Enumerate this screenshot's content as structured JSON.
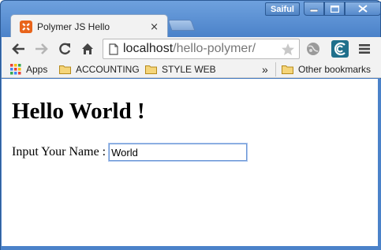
{
  "window": {
    "user_name": "Saiful",
    "controls": [
      "minimize",
      "maximize",
      "close"
    ]
  },
  "tab": {
    "title": "Polymer JS Hello",
    "favicon": "xampp-icon",
    "close_glyph": "×"
  },
  "toolbar": {
    "url_host": "localhost",
    "url_path": "/hello-polymer/"
  },
  "bookmarks": {
    "apps_label": "Apps",
    "items": [
      "ACCOUNTING",
      "STYLE WEB"
    ],
    "overflow": "»",
    "other": "Other bookmarks"
  },
  "page": {
    "heading": "Hello World !",
    "input_label": "Input Your Name :",
    "input_value": "World"
  },
  "colors": {
    "frame": "#4b82c9",
    "favicon": "#e8641b",
    "input_border": "#6d98d6"
  }
}
